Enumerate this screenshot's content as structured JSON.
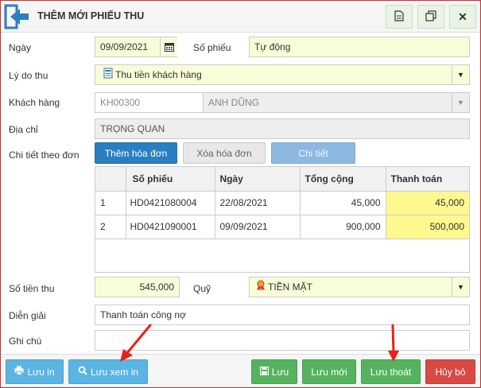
{
  "header": {
    "title": "THÊM MỚI PHIẾU THU"
  },
  "form": {
    "date_label": "Ngày",
    "date_value": "09/09/2021",
    "so_phieu_label": "Số phiếu",
    "so_phieu_value": "Tự động",
    "reason_label": "Lý do thu",
    "reason_value": "Thu tiền khách hàng",
    "customer_label": "Khách hàng",
    "customer_code": "KH00300",
    "customer_name": "ANH DŨNG",
    "address_label": "Địa chỉ",
    "address_value": "TRỌNG QUAN",
    "detail_label": "Chi tiết theo đơn",
    "add_order_label": "Thêm hóa đơn",
    "remove_order_label": "Xóa hóa đơn",
    "detail_button_label": "Chi tiết",
    "amount_label": "Số tiền thu",
    "amount_value": "545,000",
    "fund_label": "Quỹ",
    "fund_value": "TIỀN MẶT",
    "description_label": "Diễn giải",
    "description_value": "Thanh toán công nợ",
    "note_label": "Ghi chú",
    "note_value": ""
  },
  "table": {
    "columns": [
      "",
      "Số phiếu",
      "Ngày",
      "Tổng cộng",
      "Thanh toán"
    ],
    "rows": [
      [
        "1",
        "HD0421080004",
        "22/08/2021",
        "45,000",
        "45,000"
      ],
      [
        "2",
        "HD0421090001",
        "09/09/2021",
        "900,000",
        "500,000"
      ]
    ]
  },
  "footer": {
    "print_label": "Lưu in",
    "save_view_label": "Lưu xem in",
    "save_label": "Lưu",
    "save_new_label": "Lưu mới",
    "save_exit_label": "Lưu thoát",
    "cancel_label": "Hủy bỏ"
  },
  "colors": {
    "accent_blue": "#2a7fc1",
    "green": "#55b35f",
    "red": "#d94a44",
    "yellow_field": "#f7fdd6",
    "pay_cell": "#fdf98e"
  },
  "icons": [
    "back-arrow-icon",
    "document-icon",
    "copy-icon",
    "close-icon",
    "calendar-icon",
    "receipt-icon",
    "medal-icon",
    "print-icon",
    "search-icon",
    "save-icon"
  ]
}
